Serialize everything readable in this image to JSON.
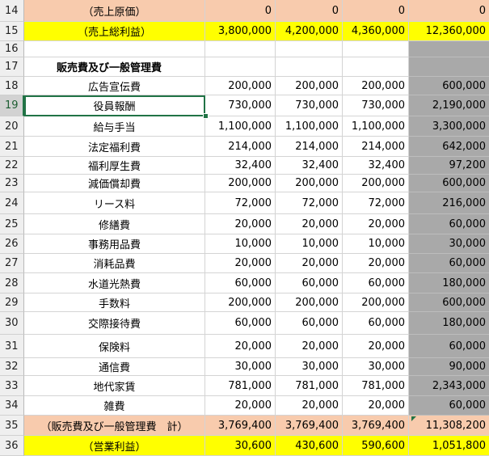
{
  "rows": [
    {
      "num": "14",
      "label": "（売上原価）",
      "b": "0",
      "c": "0",
      "d": "0",
      "e": "0"
    },
    {
      "num": "15",
      "label": "（売上総利益）",
      "b": "3,800,000",
      "c": "4,200,000",
      "d": "4,360,000",
      "e": "12,360,000"
    },
    {
      "num": "16",
      "label": "",
      "b": "",
      "c": "",
      "d": "",
      "e": ""
    },
    {
      "num": "17",
      "label": "販売費及び一般管理費",
      "b": "",
      "c": "",
      "d": "",
      "e": ""
    },
    {
      "num": "18",
      "label": "広告宣伝費",
      "b": "200,000",
      "c": "200,000",
      "d": "200,000",
      "e": "600,000"
    },
    {
      "num": "19",
      "label": "役員報酬",
      "b": "730,000",
      "c": "730,000",
      "d": "730,000",
      "e": "2,190,000"
    },
    {
      "num": "20",
      "label": "給与手当",
      "b": "1,100,000",
      "c": "1,100,000",
      "d": "1,100,000",
      "e": "3,300,000"
    },
    {
      "num": "21",
      "label": "法定福利費",
      "b": "214,000",
      "c": "214,000",
      "d": "214,000",
      "e": "642,000"
    },
    {
      "num": "22",
      "label": "福利厚生費",
      "b": "32,400",
      "c": "32,400",
      "d": "32,400",
      "e": "97,200"
    },
    {
      "num": "23",
      "label": "減価償却費",
      "b": "200,000",
      "c": "200,000",
      "d": "200,000",
      "e": "600,000"
    },
    {
      "num": "24",
      "label": "リース料",
      "b": "72,000",
      "c": "72,000",
      "d": "72,000",
      "e": "216,000"
    },
    {
      "num": "25",
      "label": "修繕費",
      "b": "20,000",
      "c": "20,000",
      "d": "20,000",
      "e": "60,000"
    },
    {
      "num": "26",
      "label": "事務用品費",
      "b": "10,000",
      "c": "10,000",
      "d": "10,000",
      "e": "30,000"
    },
    {
      "num": "27",
      "label": "消耗品費",
      "b": "20,000",
      "c": "20,000",
      "d": "20,000",
      "e": "60,000"
    },
    {
      "num": "28",
      "label": "水道光熱費",
      "b": "60,000",
      "c": "60,000",
      "d": "60,000",
      "e": "180,000"
    },
    {
      "num": "29",
      "label": "手数料",
      "b": "200,000",
      "c": "200,000",
      "d": "200,000",
      "e": "600,000"
    },
    {
      "num": "30",
      "label": "交際接待費",
      "b": "60,000",
      "c": "60,000",
      "d": "60,000",
      "e": "180,000"
    },
    {
      "num": "31",
      "label": "保険料",
      "b": "20,000",
      "c": "20,000",
      "d": "20,000",
      "e": "60,000"
    },
    {
      "num": "32",
      "label": "通信費",
      "b": "30,000",
      "c": "30,000",
      "d": "30,000",
      "e": "90,000"
    },
    {
      "num": "33",
      "label": "地代家賃",
      "b": "781,000",
      "c": "781,000",
      "d": "781,000",
      "e": "2,343,000"
    },
    {
      "num": "34",
      "label": "雑費",
      "b": "20,000",
      "c": "20,000",
      "d": "20,000",
      "e": "60,000"
    },
    {
      "num": "35",
      "label": "（販売費及び一般管理費　計）",
      "b": "3,769,400",
      "c": "3,769,400",
      "d": "3,769,400",
      "e": "11,308,200"
    },
    {
      "num": "36",
      "label": "（営業利益）",
      "b": "30,600",
      "c": "430,600",
      "d": "590,600",
      "e": "1,051,800"
    }
  ],
  "colors": {
    "salmon": "#f8cbad",
    "yellow": "#ffff00",
    "gray_fill": "#a9a9a9",
    "selection": "#217346"
  },
  "selected_cell_row": "19"
}
